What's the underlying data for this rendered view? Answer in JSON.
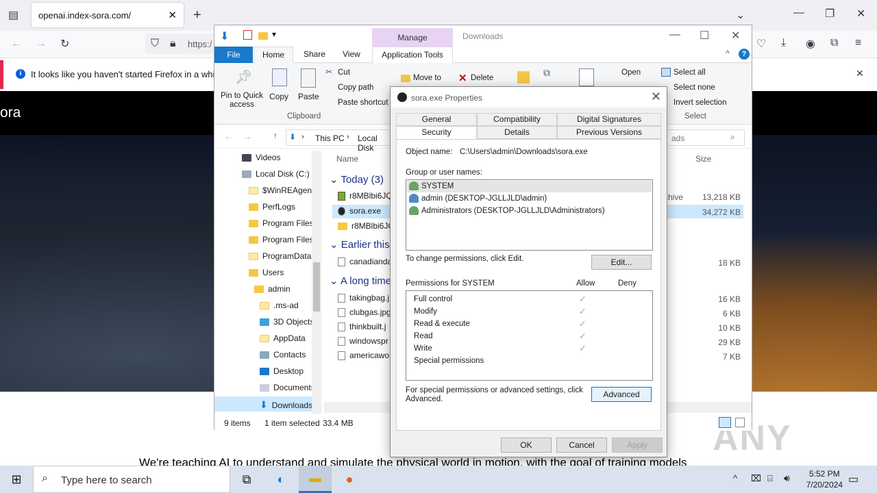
{
  "browser": {
    "tab_title": "openai.index-sora.com/",
    "url_fragment": "https:/",
    "notice": "It looks like you haven't started Firefox in a while. D"
  },
  "site": {
    "logo": "ora",
    "tagline": "We're teaching AI to understand and simulate the physical world in motion, with the goal of training models",
    "watermark": "ANY RUN"
  },
  "explorer": {
    "manage_tab": "Manage",
    "title": "Downloads",
    "tabs": {
      "file": "File",
      "home": "Home",
      "share": "Share",
      "view": "View",
      "app_tools": "Application Tools"
    },
    "ribbon": {
      "pin": "Pin to Quick access",
      "copy": "Copy",
      "paste": "Paste",
      "cut": "Cut",
      "copy_path": "Copy path",
      "paste_shortcut": "Paste shortcut",
      "clipboard": "Clipboard",
      "move_to": "Move to",
      "delete": "Delete",
      "open": "Open",
      "select_all": "Select all",
      "select_none": "Select none",
      "invert_selection": "Invert selection",
      "select": "Select"
    },
    "address": {
      "this_pc": "This PC",
      "local_disk": "Local Disk",
      "search_tail": "ads"
    },
    "nav": [
      {
        "label": "Videos"
      },
      {
        "label": "Local Disk (C:)"
      },
      {
        "label": "$WinREAgent"
      },
      {
        "label": "PerfLogs"
      },
      {
        "label": "Program Files"
      },
      {
        "label": "Program Files"
      },
      {
        "label": "ProgramData"
      },
      {
        "label": "Users"
      },
      {
        "label": "admin"
      },
      {
        "label": ".ms-ad"
      },
      {
        "label": "3D Objects"
      },
      {
        "label": "AppData"
      },
      {
        "label": "Contacts"
      },
      {
        "label": "Desktop"
      },
      {
        "label": "Documents"
      },
      {
        "label": "Downloads"
      }
    ],
    "columns": {
      "name": "Name",
      "size": "Size"
    },
    "groups": {
      "today": "Today (3)",
      "earlier": "Earlier this y",
      "long_ago": "A long time"
    },
    "files": [
      {
        "name": "r8MBlbi6JQ",
        "extra": "chive",
        "size": "13,218 KB"
      },
      {
        "name": "sora.exe",
        "extra": "",
        "size": "34,272 KB"
      },
      {
        "name": "r8MBlbi6JQ",
        "extra": "",
        "size": ""
      },
      {
        "name": "canadianda",
        "extra": "",
        "size": "18 KB"
      },
      {
        "name": "takingbag.j",
        "extra": "",
        "size": "16 KB"
      },
      {
        "name": "clubgas.jpg",
        "extra": "",
        "size": "6 KB"
      },
      {
        "name": "thinkbuilt.j",
        "extra": "",
        "size": "10 KB"
      },
      {
        "name": "windowspr",
        "extra": "",
        "size": "29 KB"
      },
      {
        "name": "americawo",
        "extra": "",
        "size": "7 KB"
      }
    ],
    "status": {
      "items": "9 items",
      "selected": "1 item selected",
      "selected_size": "33.4 MB"
    }
  },
  "dialog": {
    "title": "sora.exe Properties",
    "tabs_row1": [
      "General",
      "Compatibility",
      "Digital Signatures"
    ],
    "tabs_row2": [
      "Security",
      "Details",
      "Previous Versions"
    ],
    "object_label": "Object name:",
    "object_value": "C:\\Users\\admin\\Downloads\\sora.exe",
    "groups_label": "Group or user names:",
    "principals": [
      "SYSTEM",
      "admin (DESKTOP-JGLLJLD\\admin)",
      "Administrators (DESKTOP-JGLLJLD\\Administrators)"
    ],
    "change_text": "To change permissions, click Edit.",
    "edit_btn": "Edit...",
    "perm_label": "Permissions for SYSTEM",
    "allow": "Allow",
    "deny": "Deny",
    "permissions": [
      {
        "name": "Full control",
        "allow": true
      },
      {
        "name": "Modify",
        "allow": true
      },
      {
        "name": "Read & execute",
        "allow": true
      },
      {
        "name": "Read",
        "allow": true
      },
      {
        "name": "Write",
        "allow": true
      },
      {
        "name": "Special permissions",
        "allow": false
      }
    ],
    "advanced_text_1": "For special permissions or advanced settings, click",
    "advanced_text_2": "Advanced.",
    "advanced_btn": "Advanced",
    "ok": "OK",
    "cancel": "Cancel",
    "apply": "Apply"
  },
  "taskbar": {
    "search_placeholder": "Type here to search",
    "time": "5:52 PM",
    "date": "7/20/2024"
  }
}
